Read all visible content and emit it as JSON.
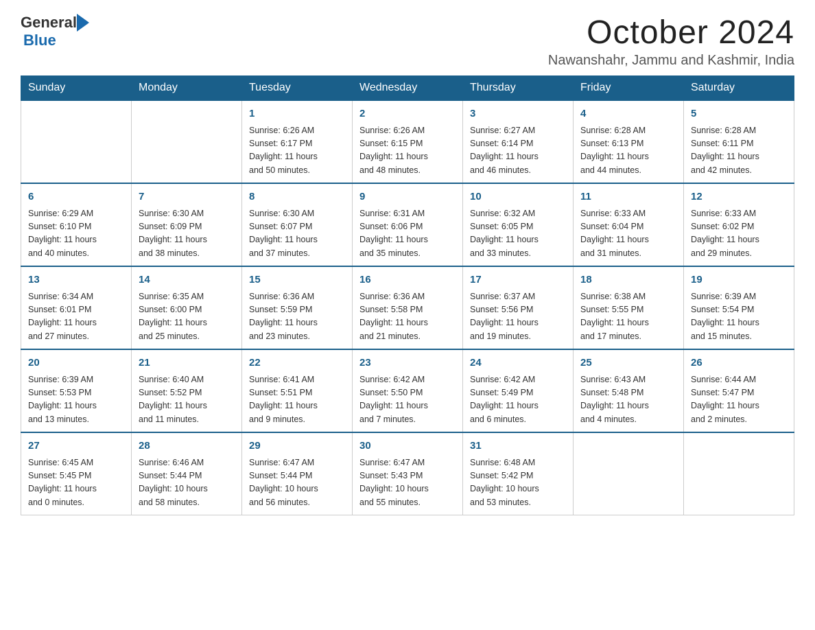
{
  "header": {
    "logo_general": "General",
    "logo_blue": "Blue",
    "month_title": "October 2024",
    "location": "Nawanshahr, Jammu and Kashmir, India"
  },
  "days_of_week": [
    "Sunday",
    "Monday",
    "Tuesday",
    "Wednesday",
    "Thursday",
    "Friday",
    "Saturday"
  ],
  "weeks": [
    [
      {
        "day": "",
        "info": ""
      },
      {
        "day": "",
        "info": ""
      },
      {
        "day": "1",
        "info": "Sunrise: 6:26 AM\nSunset: 6:17 PM\nDaylight: 11 hours\nand 50 minutes."
      },
      {
        "day": "2",
        "info": "Sunrise: 6:26 AM\nSunset: 6:15 PM\nDaylight: 11 hours\nand 48 minutes."
      },
      {
        "day": "3",
        "info": "Sunrise: 6:27 AM\nSunset: 6:14 PM\nDaylight: 11 hours\nand 46 minutes."
      },
      {
        "day": "4",
        "info": "Sunrise: 6:28 AM\nSunset: 6:13 PM\nDaylight: 11 hours\nand 44 minutes."
      },
      {
        "day": "5",
        "info": "Sunrise: 6:28 AM\nSunset: 6:11 PM\nDaylight: 11 hours\nand 42 minutes."
      }
    ],
    [
      {
        "day": "6",
        "info": "Sunrise: 6:29 AM\nSunset: 6:10 PM\nDaylight: 11 hours\nand 40 minutes."
      },
      {
        "day": "7",
        "info": "Sunrise: 6:30 AM\nSunset: 6:09 PM\nDaylight: 11 hours\nand 38 minutes."
      },
      {
        "day": "8",
        "info": "Sunrise: 6:30 AM\nSunset: 6:07 PM\nDaylight: 11 hours\nand 37 minutes."
      },
      {
        "day": "9",
        "info": "Sunrise: 6:31 AM\nSunset: 6:06 PM\nDaylight: 11 hours\nand 35 minutes."
      },
      {
        "day": "10",
        "info": "Sunrise: 6:32 AM\nSunset: 6:05 PM\nDaylight: 11 hours\nand 33 minutes."
      },
      {
        "day": "11",
        "info": "Sunrise: 6:33 AM\nSunset: 6:04 PM\nDaylight: 11 hours\nand 31 minutes."
      },
      {
        "day": "12",
        "info": "Sunrise: 6:33 AM\nSunset: 6:02 PM\nDaylight: 11 hours\nand 29 minutes."
      }
    ],
    [
      {
        "day": "13",
        "info": "Sunrise: 6:34 AM\nSunset: 6:01 PM\nDaylight: 11 hours\nand 27 minutes."
      },
      {
        "day": "14",
        "info": "Sunrise: 6:35 AM\nSunset: 6:00 PM\nDaylight: 11 hours\nand 25 minutes."
      },
      {
        "day": "15",
        "info": "Sunrise: 6:36 AM\nSunset: 5:59 PM\nDaylight: 11 hours\nand 23 minutes."
      },
      {
        "day": "16",
        "info": "Sunrise: 6:36 AM\nSunset: 5:58 PM\nDaylight: 11 hours\nand 21 minutes."
      },
      {
        "day": "17",
        "info": "Sunrise: 6:37 AM\nSunset: 5:56 PM\nDaylight: 11 hours\nand 19 minutes."
      },
      {
        "day": "18",
        "info": "Sunrise: 6:38 AM\nSunset: 5:55 PM\nDaylight: 11 hours\nand 17 minutes."
      },
      {
        "day": "19",
        "info": "Sunrise: 6:39 AM\nSunset: 5:54 PM\nDaylight: 11 hours\nand 15 minutes."
      }
    ],
    [
      {
        "day": "20",
        "info": "Sunrise: 6:39 AM\nSunset: 5:53 PM\nDaylight: 11 hours\nand 13 minutes."
      },
      {
        "day": "21",
        "info": "Sunrise: 6:40 AM\nSunset: 5:52 PM\nDaylight: 11 hours\nand 11 minutes."
      },
      {
        "day": "22",
        "info": "Sunrise: 6:41 AM\nSunset: 5:51 PM\nDaylight: 11 hours\nand 9 minutes."
      },
      {
        "day": "23",
        "info": "Sunrise: 6:42 AM\nSunset: 5:50 PM\nDaylight: 11 hours\nand 7 minutes."
      },
      {
        "day": "24",
        "info": "Sunrise: 6:42 AM\nSunset: 5:49 PM\nDaylight: 11 hours\nand 6 minutes."
      },
      {
        "day": "25",
        "info": "Sunrise: 6:43 AM\nSunset: 5:48 PM\nDaylight: 11 hours\nand 4 minutes."
      },
      {
        "day": "26",
        "info": "Sunrise: 6:44 AM\nSunset: 5:47 PM\nDaylight: 11 hours\nand 2 minutes."
      }
    ],
    [
      {
        "day": "27",
        "info": "Sunrise: 6:45 AM\nSunset: 5:45 PM\nDaylight: 11 hours\nand 0 minutes."
      },
      {
        "day": "28",
        "info": "Sunrise: 6:46 AM\nSunset: 5:44 PM\nDaylight: 10 hours\nand 58 minutes."
      },
      {
        "day": "29",
        "info": "Sunrise: 6:47 AM\nSunset: 5:44 PM\nDaylight: 10 hours\nand 56 minutes."
      },
      {
        "day": "30",
        "info": "Sunrise: 6:47 AM\nSunset: 5:43 PM\nDaylight: 10 hours\nand 55 minutes."
      },
      {
        "day": "31",
        "info": "Sunrise: 6:48 AM\nSunset: 5:42 PM\nDaylight: 10 hours\nand 53 minutes."
      },
      {
        "day": "",
        "info": ""
      },
      {
        "day": "",
        "info": ""
      }
    ]
  ]
}
